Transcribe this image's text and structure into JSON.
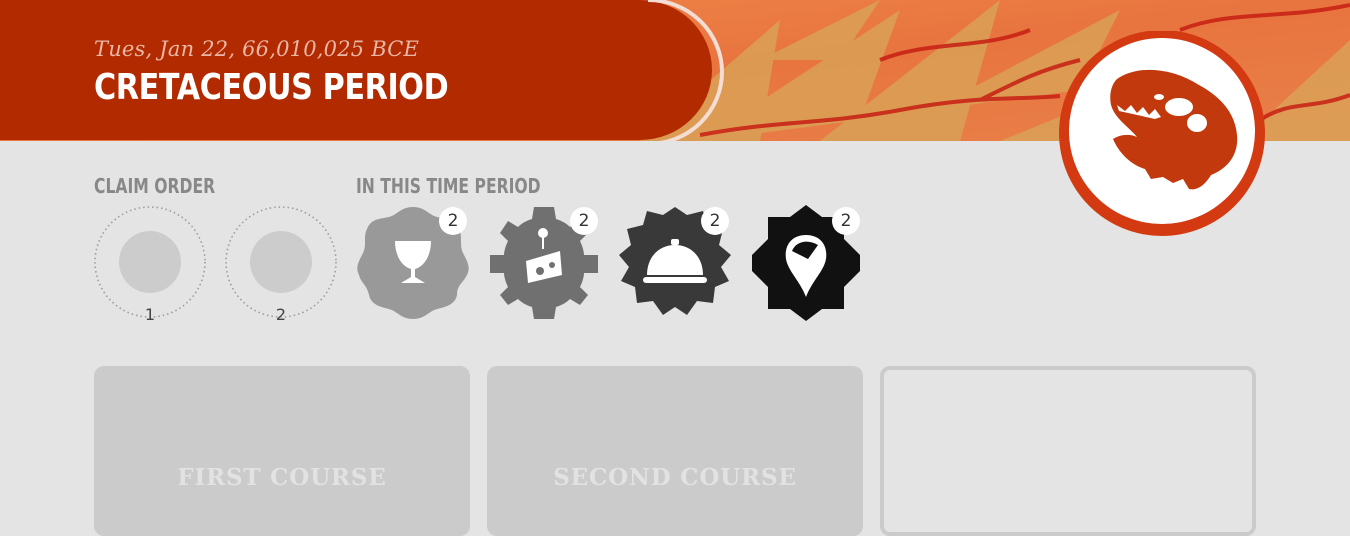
{
  "header": {
    "date": "Tues, Jan 22, 66,010,025 BCE",
    "period": "CRETACEOUS PERIOD",
    "banner_color": "#b22a00",
    "accent_color": "#c2390d"
  },
  "claim_order": {
    "label": "CLAIM ORDER",
    "slots": [
      {
        "number": "1"
      },
      {
        "number": "2"
      }
    ]
  },
  "time_period": {
    "label": "IN THIS TIME PERIOD",
    "items": [
      {
        "icon": "egg-cup-icon",
        "count": "2",
        "color": "#999999"
      },
      {
        "icon": "cheese-icon",
        "count": "2",
        "color": "#707070"
      },
      {
        "icon": "serving-cloche-icon",
        "count": "2",
        "color": "#393939"
      },
      {
        "icon": "map-pin-icon",
        "count": "2",
        "color": "#111111"
      }
    ]
  },
  "courses": [
    {
      "label": "FIRST COURSE"
    },
    {
      "label": "SECOND COURSE"
    },
    {
      "label": ""
    }
  ],
  "logo": {
    "icon": "t-rex-skull-icon"
  }
}
